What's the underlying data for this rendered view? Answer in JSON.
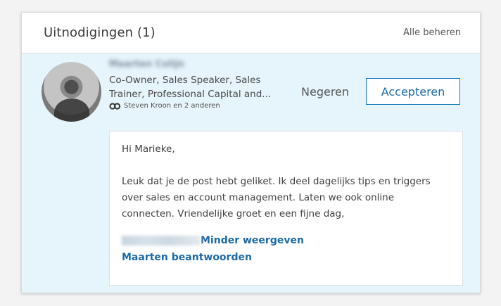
{
  "header": {
    "title": "Uitnodigingen (1)",
    "manage_label": "Alle beheren"
  },
  "invitation": {
    "name": "Maarten Colijn",
    "headline_line1": "Co-Owner, Sales Speaker, Sales",
    "headline_line2": "Trainer, Professional Capital and...",
    "mutual_connections": "Steven Kroon en 2 anderen",
    "ignore_label": "Negeren",
    "accept_label": "Accepteren"
  },
  "message": {
    "greeting": "Hi Marieke,",
    "line1": "Leuk dat je de post hebt geliket. Ik deel dagelijks tips en triggers",
    "line2": "over sales en account management. Laten we ook online",
    "line3": "connecten. Vriendelijke groet en een fijne dag,",
    "show_less_label": "Minder weergeven",
    "reply_label": "Maarten beantwoorden"
  },
  "colors": {
    "accent": "#1c6aa8",
    "invite_background": "#e6f4fb"
  },
  "icons": {
    "mutual": "mutual-connections-icon"
  }
}
